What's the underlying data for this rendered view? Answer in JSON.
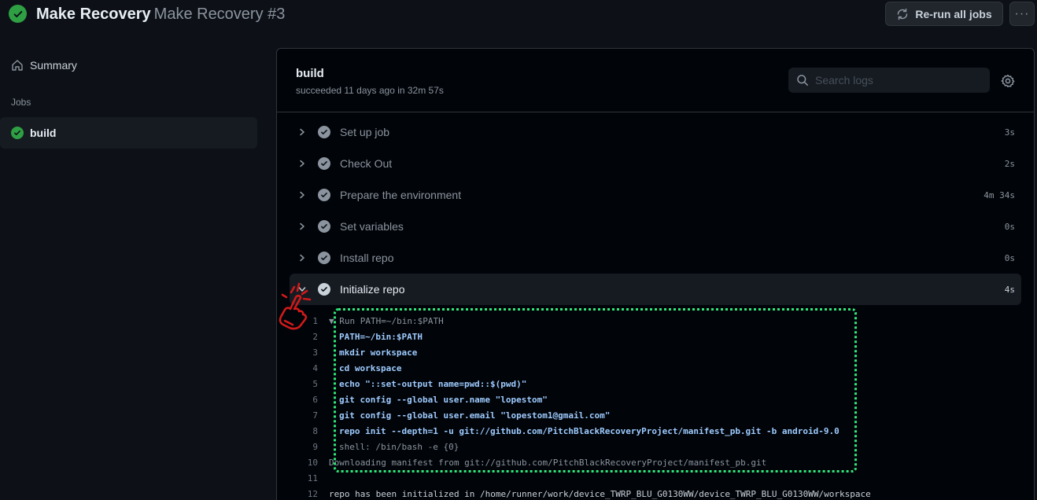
{
  "header": {
    "workflow_name": "Make Recovery",
    "run_name": "Make Recovery #3",
    "status_icon": "check-circle-icon",
    "rerun_label": "Re-run all jobs",
    "more_label": "···"
  },
  "sidebar": {
    "summary_label": "Summary",
    "jobs_heading": "Jobs",
    "jobs": [
      {
        "label": "build",
        "status": "success"
      }
    ]
  },
  "job": {
    "title": "build",
    "subtitle": "succeeded 11 days ago in 32m 57s",
    "search_placeholder": "Search logs",
    "steps": [
      {
        "label": "Set up job",
        "duration": "3s",
        "expanded": false
      },
      {
        "label": "Check Out",
        "duration": "2s",
        "expanded": false
      },
      {
        "label": "Prepare the environment",
        "duration": "4m 34s",
        "expanded": false
      },
      {
        "label": "Set variables",
        "duration": "0s",
        "expanded": false
      },
      {
        "label": "Install repo",
        "duration": "0s",
        "expanded": false
      },
      {
        "label": "Initialize repo",
        "duration": "4s",
        "expanded": true
      }
    ],
    "log_lines": [
      {
        "num": "1",
        "text": "▼ Run PATH=~/bin:$PATH",
        "kind": "group"
      },
      {
        "num": "2",
        "text": "PATH=~/bin:$PATH",
        "kind": "cmd"
      },
      {
        "num": "3",
        "text": "mkdir workspace",
        "kind": "cmd"
      },
      {
        "num": "4",
        "text": "cd workspace",
        "kind": "cmd"
      },
      {
        "num": "5",
        "text": "echo \"::set-output name=pwd::$(pwd)\"",
        "kind": "cmd"
      },
      {
        "num": "6",
        "text": "git config --global user.name \"lopestom\"",
        "kind": "cmd"
      },
      {
        "num": "7",
        "text": "git config --global user.email \"lopestom1@gmail.com\"",
        "kind": "cmd"
      },
      {
        "num": "8",
        "text": "repo init --depth=1 -u git://github.com/PitchBlackRecoveryProject/manifest_pb.git -b android-9.0",
        "kind": "cmd"
      },
      {
        "num": "9",
        "text": "shell: /bin/bash -e {0}",
        "kind": "shell"
      },
      {
        "num": "10",
        "text": "Downloading manifest from git://github.com/PitchBlackRecoveryProject/manifest_pb.git",
        "kind": "out"
      },
      {
        "num": "11",
        "text": "",
        "kind": "out"
      },
      {
        "num": "12",
        "text": "repo has been initialized in /home/runner/work/device_TWRP_BLU_G0130WW/device_TWRP_BLU_G0130WW/workspace",
        "kind": "out"
      }
    ]
  },
  "annotation": {
    "highlight_color": "#2ee87a",
    "pointer_color": "#d11a1a"
  }
}
